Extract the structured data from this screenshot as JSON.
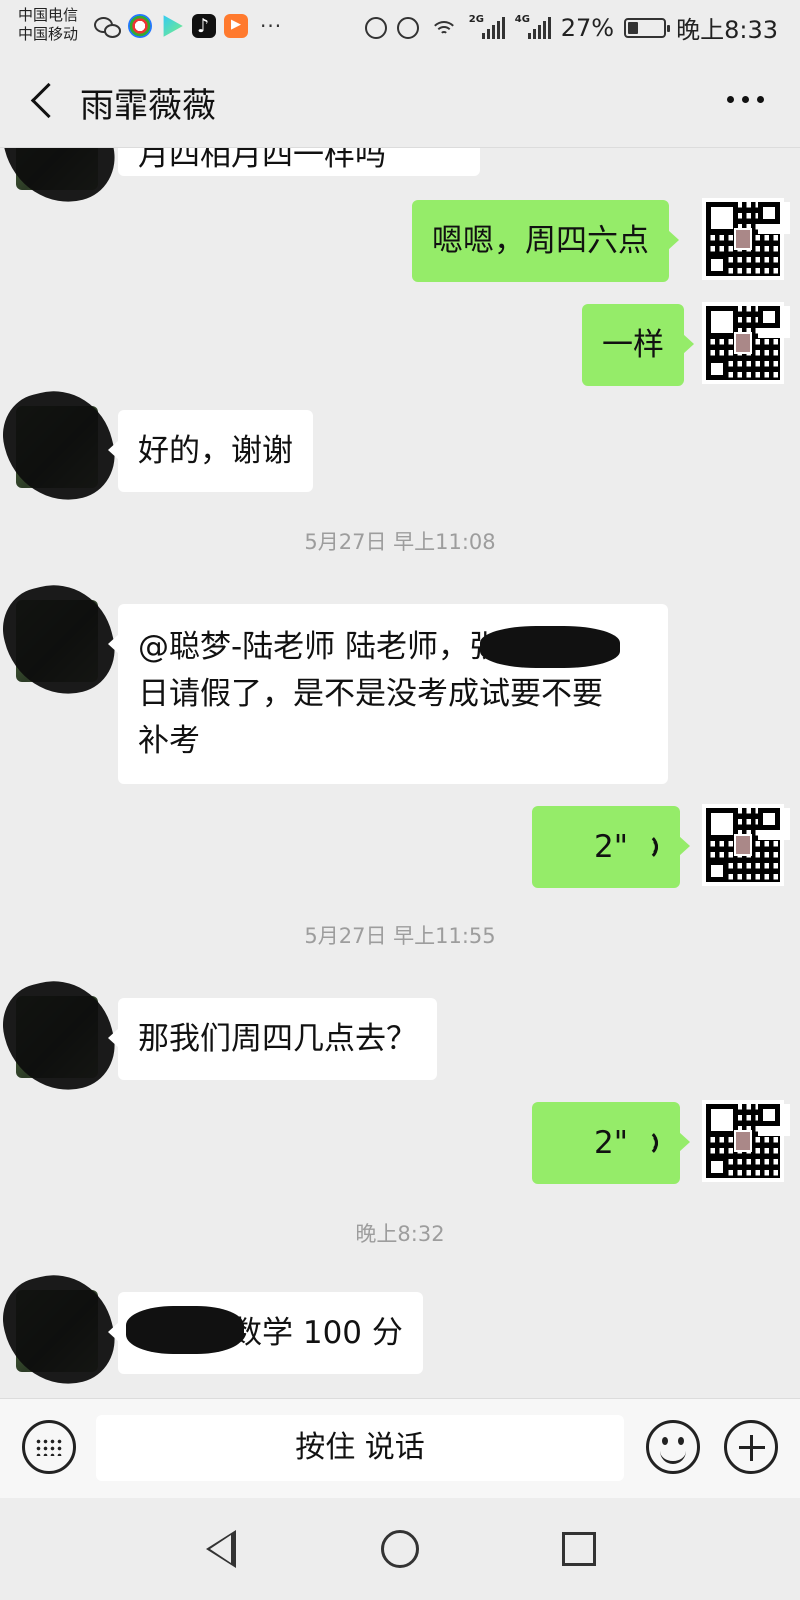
{
  "status_bar": {
    "carrier_1": "中国电信",
    "carrier_2": "中国移动",
    "net_1": "2G",
    "net_2": "4G",
    "battery": "27%",
    "time": "晚上8:33"
  },
  "header": {
    "title": "雨霏薇薇"
  },
  "messages": {
    "m0": {
      "text": "月四相月四一样吗",
      "side": "in"
    },
    "m1": {
      "text": "嗯嗯，周四六点",
      "side": "out"
    },
    "m2": {
      "text": "一样",
      "side": "out"
    },
    "m3": {
      "text": "好的，谢谢",
      "side": "in"
    },
    "ts1": "5月27日 早上11:08",
    "m4": {
      "line1": "@聪梦-陆老师  陆老师，张怡慧周",
      "line2": "日请假了，是不是没考成试要不要",
      "line3": "补考",
      "side": "in"
    },
    "m5": {
      "duration": "2\"",
      "side": "out"
    },
    "ts2": "5月27日 早上11:55",
    "m6": {
      "text": "那我们周四几点去？",
      "side": "in"
    },
    "m7": {
      "duration": "2\"",
      "side": "out"
    },
    "ts3": "晚上8:32",
    "m8": {
      "text": "张怡慧数学 100 分",
      "side": "in"
    }
  },
  "input_bar": {
    "hold_to_talk": "按住 说话"
  },
  "colors": {
    "background": "#ededed",
    "outgoing_bubble": "#95ec69",
    "incoming_bubble": "#ffffff",
    "timestamp_text": "#9d9d9d"
  },
  "icons": {
    "back": "chevron-left-icon",
    "more": "more-dots-icon",
    "keyboard": "keyboard-icon",
    "emoji": "emoji-icon",
    "plus": "plus-icon",
    "voice": "voice-wave-icon"
  }
}
